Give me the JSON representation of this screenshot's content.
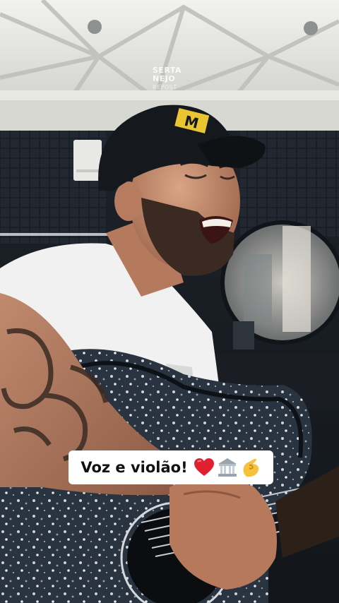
{
  "watermark": {
    "line1": "SERTA",
    "line2": "NEJO",
    "line3": "REPOST"
  },
  "caption": {
    "text": "Voz e violão!"
  },
  "emojis": [
    "red-heart",
    "classical-building",
    "pinching-hand"
  ],
  "colors": {
    "caption_bg": "#ffffff",
    "caption_text": "#111111",
    "cap": "#15181c",
    "cap_logo": "#e8c531",
    "shirt": "#f1f1f1",
    "guitar": "#2a3340"
  }
}
